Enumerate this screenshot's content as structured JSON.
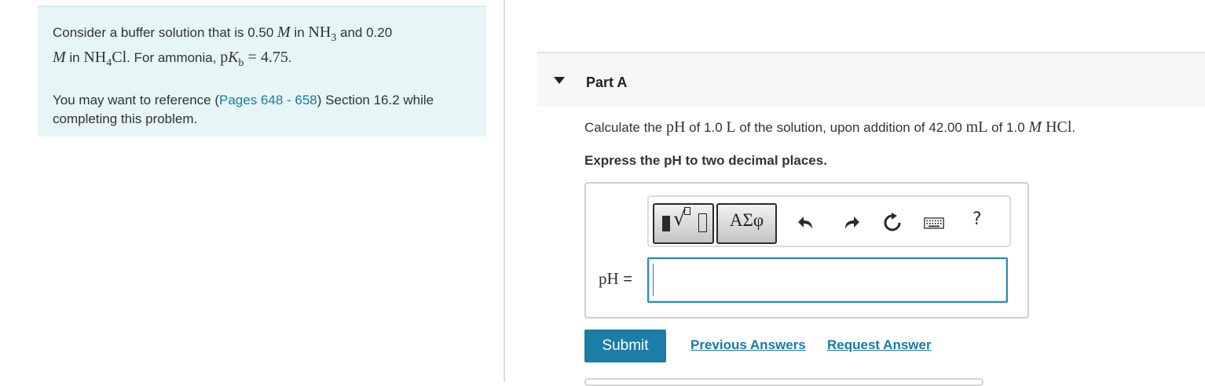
{
  "intro": {
    "line1_pre": "Consider a buffer solution that is 0.50 ",
    "molar": "M",
    "line1_mid": " in ",
    "nh3_base": "NH",
    "nh3_sub": "3",
    "line1_post": " and 0.20",
    "line2_molar": "M",
    "line2_mid": " in ",
    "nh4cl_a": "NH",
    "nh4cl_sub": "4",
    "nh4cl_b": "Cl",
    "line2_post": ". For ammonia, ",
    "pkb_p": "p",
    "pkb_k": "K",
    "pkb_sub": "b",
    "pkb_eq": " = 4.75",
    "line2_end": ".",
    "ref_pre": "You may want to reference (",
    "ref_link": "Pages 648 - 658",
    "ref_post": ") Section 16.2 while completing this problem."
  },
  "part": {
    "title": "Part A",
    "q_pre": "Calculate the ",
    "q_ph": "pH",
    "q_mid1": " of 1.0 ",
    "q_l": "L",
    "q_mid2": " of the solution, upon addition of 42.00 ",
    "q_ml": "mL",
    "q_mid3": " of 1.0 ",
    "q_m": "M",
    "q_hcl": " HCl",
    "q_end": ".",
    "instruction": "Express the pH to two decimal places."
  },
  "toolbar": {
    "symbols_label": "ΑΣφ",
    "help_label": "?",
    "icons": [
      "templates-icon",
      "symbols-icon",
      "undo-icon",
      "redo-icon",
      "reset-icon",
      "keyboard-icon",
      "help-icon"
    ]
  },
  "answer": {
    "label_var": "pH",
    "label_eq": " =",
    "value": ""
  },
  "actions": {
    "submit": "Submit",
    "previous_answers": "Previous Answers",
    "request_answer": "Request Answer"
  },
  "colors": {
    "intro_bg": "#e6f5f5",
    "link": "#1a7aa6",
    "submit_bg": "#1a7ea6",
    "input_border": "#2e8bb3"
  }
}
